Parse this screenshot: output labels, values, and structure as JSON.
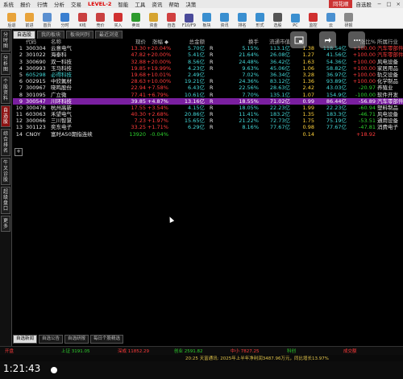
{
  "menu": {
    "items": [
      "系统",
      "报价",
      "行情",
      "分析",
      "交易",
      "LEVEL-2",
      "智能",
      "工具",
      "资讯",
      "帮助",
      "决策"
    ],
    "brand": "同花顺",
    "window_title": "自选股"
  },
  "toolbar": {
    "buttons": [
      {
        "icon": "back-icon",
        "label": "后退"
      },
      {
        "icon": "forward-icon",
        "label": "前进"
      },
      {
        "icon": "home-icon",
        "label": "首页"
      },
      {
        "icon": "clock-icon",
        "label": "分时"
      },
      {
        "icon": "kline-icon",
        "label": "K线"
      },
      {
        "icon": "board-icon",
        "label": "竞价"
      },
      {
        "icon": "buy-icon",
        "label": "买入"
      },
      {
        "icon": "sell-icon",
        "label": "卖出"
      },
      {
        "icon": "cash-icon",
        "label": "资金"
      },
      {
        "icon": "self-icon",
        "label": "自选"
      },
      {
        "icon": "f10-icon",
        "label": "F10/F9"
      },
      {
        "icon": "zoom-icon",
        "label": "板块"
      },
      {
        "icon": "news-icon",
        "label": "资讯"
      },
      {
        "icon": "sort-icon",
        "label": "排名"
      },
      {
        "icon": "form-icon",
        "label": "形式"
      },
      {
        "icon": "select-icon",
        "label": "选股"
      },
      {
        "icon": "pc-icon",
        "label": "PC"
      },
      {
        "icon": "monitor-icon",
        "label": "监控"
      },
      {
        "icon": "cloud-icon",
        "label": "云"
      },
      {
        "icon": "chart-icon",
        "label": "研报"
      }
    ]
  },
  "left_tabs": [
    "分时图",
    "分析图",
    "个股资料",
    "自选股",
    "综合排名",
    "牛叉诊股",
    "超级盘口",
    "更多"
  ],
  "tabs": [
    "自选股",
    "我的板块",
    "板块同列",
    "最近浏览"
  ],
  "table": {
    "headers": {
      "idx": "",
      "code": "代码",
      "name": "名称",
      "price": "现价",
      "chg": "涨幅 ◆",
      "amt": "总金额",
      "flag": "",
      "turn": "换手",
      "mcap": "流通市值",
      "x": "",
      "y": "",
      "z": "涨比%",
      "ind": "所属行业"
    },
    "rows": [
      {
        "idx": "1",
        "code": "300304",
        "name": "云意电气",
        "price": "13.30",
        "chg": "+20.04%",
        "amt": "5.70亿",
        "flag": "R",
        "turn": "5.15%",
        "mcap": "113.1亿",
        "x": "1.38",
        "y": "118.54亿",
        "z": "+100.00",
        "ind": "汽车零部件",
        "cc": "red",
        "ic": "red"
      },
      {
        "idx": "2",
        "code": "301022",
        "name": "海泰科",
        "price": "47.82",
        "chg": "+20.00%",
        "amt": "5.41亿",
        "flag": "R",
        "turn": "21.64%",
        "mcap": "26.08亿",
        "x": "1.27",
        "y": "41.56亿",
        "z": "+100.00",
        "ind": "汽车零部件",
        "cc": "red",
        "ic": "red"
      },
      {
        "idx": "3",
        "code": "300690",
        "name": "双一科技",
        "price": "32.88",
        "chg": "+20.00%",
        "amt": "8.56亿",
        "flag": "R",
        "turn": "24.48%",
        "mcap": "36.42亿",
        "x": "1.63",
        "y": "54.36亿",
        "z": "+100.00",
        "ind": "风电设备",
        "cc": "red",
        "ic": "wht"
      },
      {
        "idx": "4",
        "code": "300993",
        "name": "玉马科技",
        "price": "19.85",
        "chg": "+19.99%",
        "amt": "4.23亿",
        "flag": "R",
        "turn": "9.63%",
        "mcap": "45.06亿",
        "x": "1.06",
        "y": "58.82亿",
        "z": "+100.00",
        "ind": "家居用品",
        "cc": "red",
        "ic": "wht"
      },
      {
        "idx": "5",
        "code": "605298",
        "name": "必得科技",
        "price": "19.68",
        "chg": "+10.01%",
        "amt": "2.49亿",
        "flag": "",
        "turn": "7.02%",
        "mcap": "36.34亿",
        "x": "3.28",
        "y": "36.97亿",
        "z": "+100.00",
        "ind": "轨交设备",
        "cc": "cyn",
        "ic": "wht"
      },
      {
        "idx": "6",
        "code": "002915",
        "name": "中欣氟材",
        "price": "28.63",
        "chg": "+10.00%",
        "amt": "19.21亿",
        "flag": "R",
        "turn": "24.36%",
        "mcap": "83.12亿",
        "x": "1.36",
        "y": "93.89亿",
        "z": "+100.00",
        "ind": "化学制品",
        "cc": "wht",
        "ic": "wht"
      },
      {
        "idx": "7",
        "code": "300967",
        "name": "晓鸣股份",
        "price": "22.94",
        "chg": "+7.58%",
        "amt": "6.43亿",
        "flag": "R",
        "turn": "22.56%",
        "mcap": "28.63亿",
        "x": "2.42",
        "y": "43.03亿",
        "z": "-20.97",
        "ind": "养殖业",
        "cc": "wht",
        "ic": "wht"
      },
      {
        "idx": "8",
        "code": "301095",
        "name": "广立微",
        "price": "77.41",
        "chg": "+6.79%",
        "amt": "10.61亿",
        "flag": "R",
        "turn": "7.70%",
        "mcap": "135.1亿",
        "x": "1.07",
        "y": "154.9亿",
        "z": "-100.00",
        "ind": "软件开发",
        "cc": "wht",
        "ic": "wht"
      },
      {
        "idx": "9",
        "code": "300547",
        "name": "川环科技",
        "price": "39.85",
        "chg": "+4.87%",
        "amt": "13.16亿",
        "flag": "R",
        "turn": "18.55%",
        "mcap": "71.02亿",
        "x": "0.99",
        "y": "86.44亿",
        "z": "-56.89",
        "ind": "汽车零部件",
        "cc": "wht",
        "ic": "wht",
        "sel": true
      },
      {
        "idx": "10",
        "code": "300478",
        "name": "杭州高新",
        "price": "17.55",
        "chg": "+3.54%",
        "amt": "4.15亿",
        "flag": "R",
        "turn": "18.05%",
        "mcap": "22.23亿",
        "x": "1.99",
        "y": "22.23亿",
        "z": "-60.94",
        "ind": "塑料制品",
        "cc": "wht",
        "ic": "wht"
      },
      {
        "idx": "11",
        "code": "603063",
        "name": "禾望电气",
        "price": "40.30",
        "chg": "+2.68%",
        "amt": "20.86亿",
        "flag": "R",
        "turn": "11.41%",
        "mcap": "183.2亿",
        "x": "1.35",
        "y": "183.3亿",
        "z": "-46.71",
        "ind": "风电设备",
        "cc": "wht",
        "ic": "wht"
      },
      {
        "idx": "12",
        "code": "300066",
        "name": "三川智慧",
        "price": "7.23",
        "chg": "+1.97%",
        "amt": "15.65亿",
        "flag": "R",
        "turn": "21.22%",
        "mcap": "72.73亿",
        "x": "1.75",
        "y": "75.19亿",
        "z": "-53.51",
        "ind": "通用设备",
        "cc": "wht",
        "ic": "wht"
      },
      {
        "idx": "13",
        "code": "301123",
        "name": "奕东电子",
        "price": "33.25",
        "chg": "+1.71%",
        "amt": "6.29亿",
        "flag": "R",
        "turn": "8.16%",
        "mcap": "77.67亿",
        "x": "0.98",
        "y": "77.67亿",
        "z": "-47.81",
        "ind": "消费电子",
        "cc": "wht",
        "ic": "wht"
      },
      {
        "idx": "14",
        "code": "CNOY",
        "name": "富时A50期指连续",
        "price": "13920",
        "chg": "-0.04%",
        "amt": "",
        "flag": "",
        "turn": "",
        "mcap": "",
        "x": "0.14",
        "y": "",
        "z": "+18.92",
        "ind": "",
        "cc": "wht",
        "ic": "wht"
      }
    ]
  },
  "bottom_tabs": [
    "自选新闻",
    "自选公告",
    "自选研报",
    "每日个股精选"
  ],
  "status_bar": {
    "items": [
      "开盘",
      "上证 3191.05",
      "深成 11852.29",
      "创业 2591.82",
      "中小 7827.25",
      "科创",
      "成交额"
    ],
    "colors": {
      "up": "#ff3b3b",
      "down": "#2ed12e"
    }
  },
  "ticker": {
    "text": "20:25 天富通讯: 2025年上半年净利润3487.96万元，同比增长13.97%"
  },
  "video": {
    "time": "1:21:43"
  },
  "colors": {
    "accent": "#c33333",
    "selected_row": "#7a1fa0",
    "up": "#ff3b3b",
    "down": "#2ed12e"
  }
}
